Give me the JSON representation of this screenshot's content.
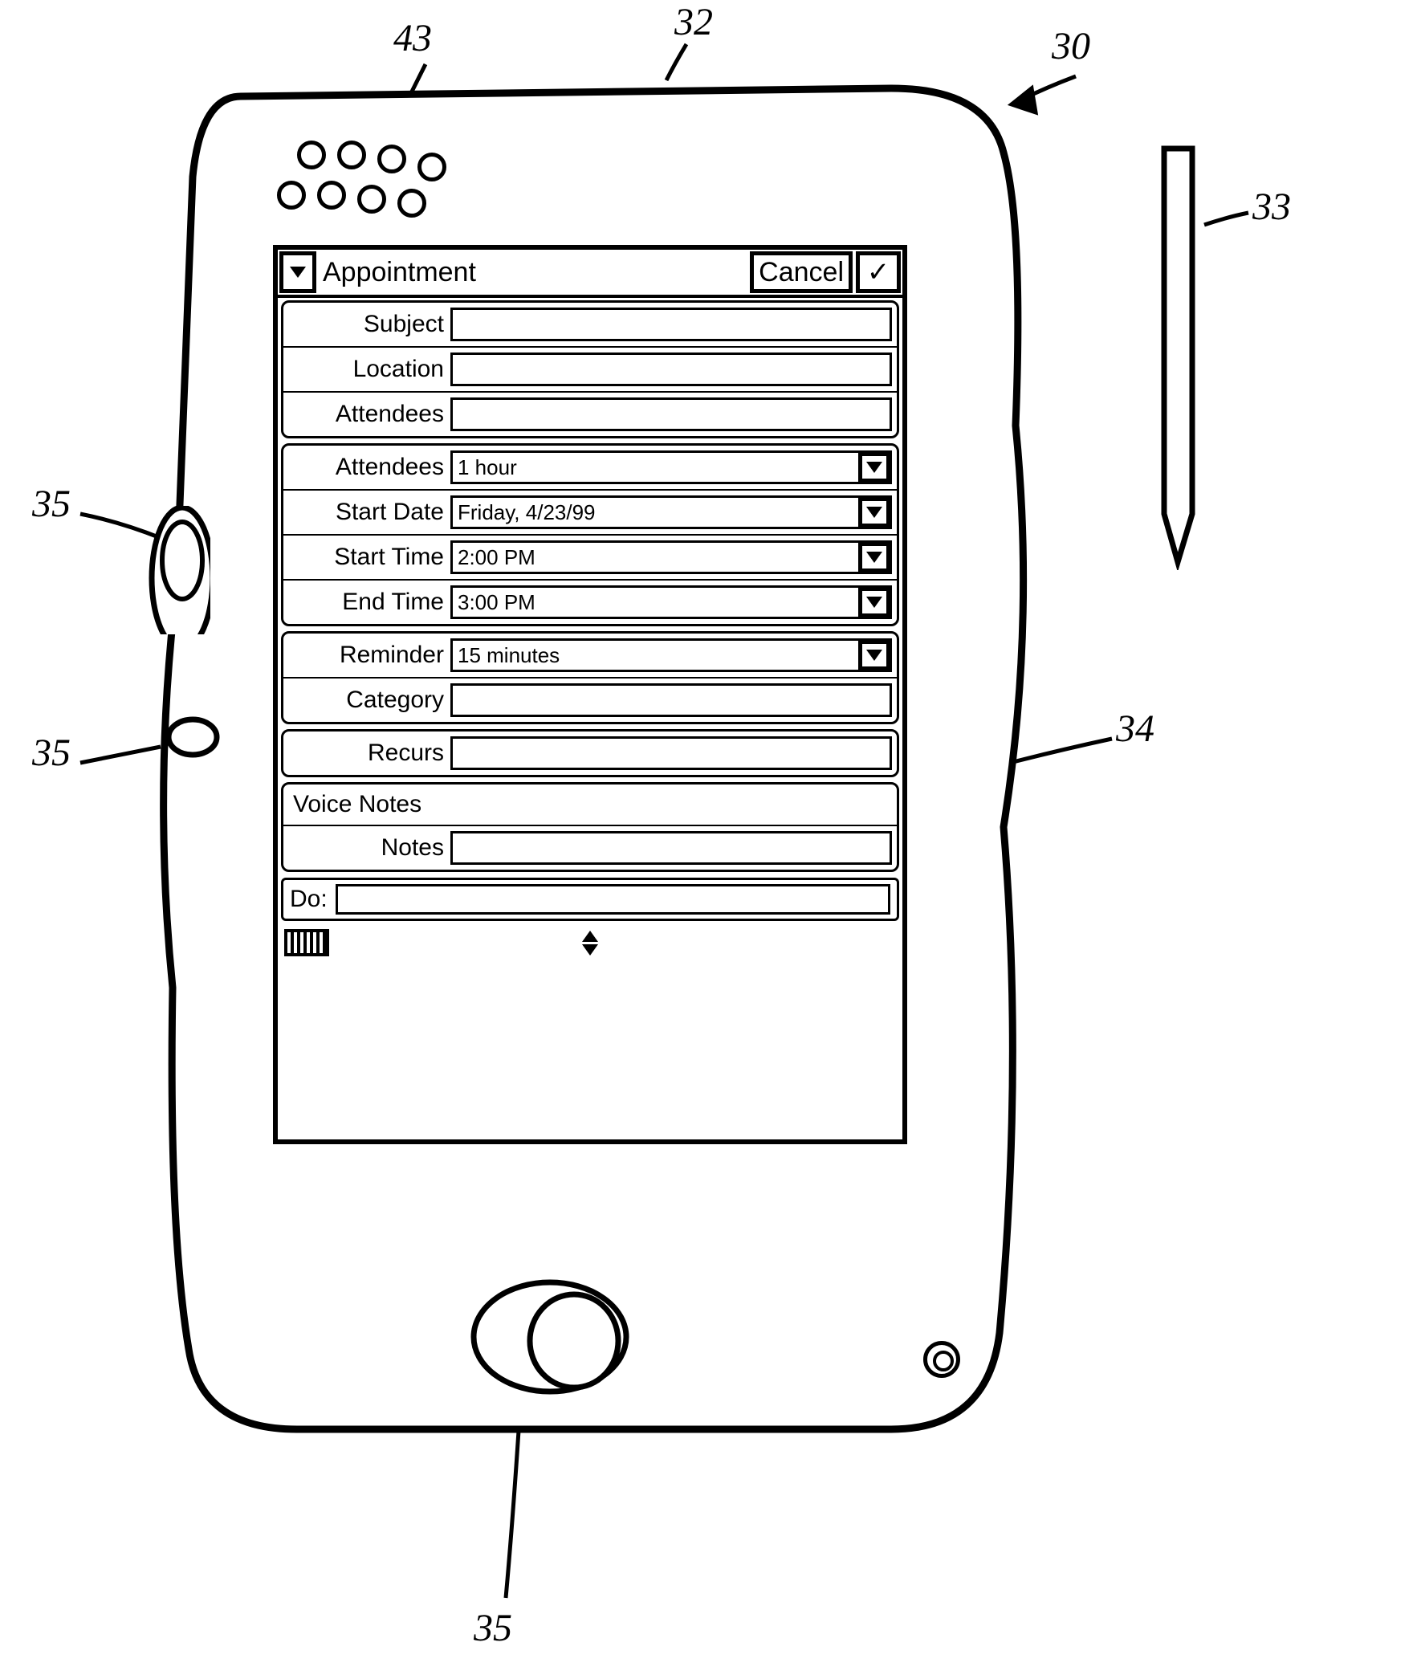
{
  "callouts": {
    "c30": "30",
    "c32": "32",
    "c33": "33",
    "c34": "34",
    "c35a": "35",
    "c35b": "35",
    "c35c": "35",
    "c43": "43"
  },
  "title": "Appointment",
  "cancel": "Cancel",
  "ok": "✓",
  "groups": [
    {
      "rows": [
        {
          "label": "Subject",
          "value": "",
          "dropdown": false
        },
        {
          "label": "Location",
          "value": "",
          "dropdown": false
        },
        {
          "label": "Attendees",
          "value": "",
          "dropdown": false
        }
      ]
    },
    {
      "rows": [
        {
          "label": "Attendees",
          "value": "1 hour",
          "dropdown": true
        },
        {
          "label": "Start Date",
          "value": "Friday, 4/23/99",
          "dropdown": true
        },
        {
          "label": "Start Time",
          "value": "2:00 PM",
          "dropdown": true
        },
        {
          "label": "End Time",
          "value": "3:00 PM",
          "dropdown": true
        }
      ]
    },
    {
      "rows": [
        {
          "label": "Reminder",
          "value": "15 minutes",
          "dropdown": true
        },
        {
          "label": "Category",
          "value": "",
          "dropdown": false
        }
      ]
    },
    {
      "rows": [
        {
          "label": "Recurs",
          "value": "",
          "dropdown": false
        }
      ]
    }
  ],
  "voice_notes_label": "Voice Notes",
  "notes_row": {
    "label": "Notes",
    "value": ""
  },
  "cmd_label": "Do:"
}
